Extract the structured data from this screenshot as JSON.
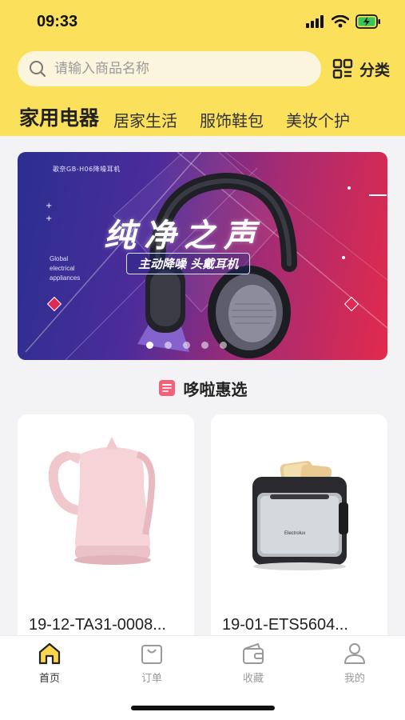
{
  "status_bar": {
    "time": "09:33"
  },
  "search": {
    "placeholder": "请输入商品名称",
    "value": ""
  },
  "category": {
    "label": "分类"
  },
  "tabs": [
    {
      "label": "家用电器",
      "active": true
    },
    {
      "label": "居家生活",
      "active": false
    },
    {
      "label": "服饰鞋包",
      "active": false
    },
    {
      "label": "美妆个护",
      "active": false
    }
  ],
  "banner": {
    "small_text": "歌奈GB-H06降噪耳机",
    "title": "纯净之声",
    "subtitle": "主动降噪 头戴耳机",
    "side_text": [
      "Global",
      "electrical",
      "appliances"
    ],
    "slide_count": 5,
    "active_slide": 1
  },
  "section": {
    "title": "哆啦惠选"
  },
  "products": [
    {
      "name": "19-12-TA31-0008...",
      "image": "pink-kettle"
    },
    {
      "name": "19-01-ETS5604...",
      "image": "toaster"
    }
  ],
  "bottom_nav": [
    {
      "label": "首页",
      "icon": "home-icon",
      "active": true
    },
    {
      "label": "订单",
      "icon": "bag-icon",
      "active": false
    },
    {
      "label": "收藏",
      "icon": "wallet-icon",
      "active": false
    },
    {
      "label": "我的",
      "icon": "user-icon",
      "active": false
    }
  ],
  "colors": {
    "header": "#fbe05b",
    "search_bg": "#fbf5dd",
    "background": "#f3f3f5",
    "accent_red": "#f2607a"
  }
}
